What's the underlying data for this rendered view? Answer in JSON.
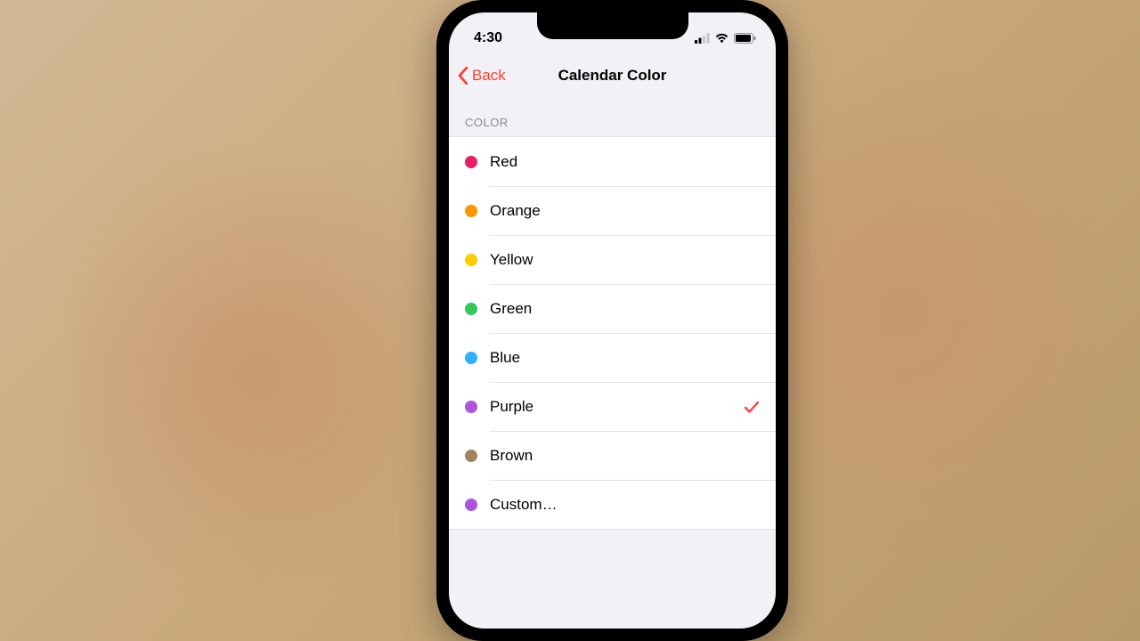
{
  "status": {
    "time": "4:30"
  },
  "nav": {
    "back_label": "Back",
    "title": "Calendar Color"
  },
  "section": {
    "header": "COLOR"
  },
  "accent": "#ff3b30",
  "colors": [
    {
      "id": "red",
      "label": "Red",
      "hex": "#e91e63",
      "selected": false
    },
    {
      "id": "orange",
      "label": "Orange",
      "hex": "#ff9500",
      "selected": false
    },
    {
      "id": "yellow",
      "label": "Yellow",
      "hex": "#ffcc00",
      "selected": false
    },
    {
      "id": "green",
      "label": "Green",
      "hex": "#34c759",
      "selected": false
    },
    {
      "id": "blue",
      "label": "Blue",
      "hex": "#30b0ff",
      "selected": false
    },
    {
      "id": "purple",
      "label": "Purple",
      "hex": "#af52de",
      "selected": true
    },
    {
      "id": "brown",
      "label": "Brown",
      "hex": "#a2845e",
      "selected": false
    },
    {
      "id": "custom",
      "label": "Custom…",
      "hex": "#af52de",
      "selected": false
    }
  ]
}
